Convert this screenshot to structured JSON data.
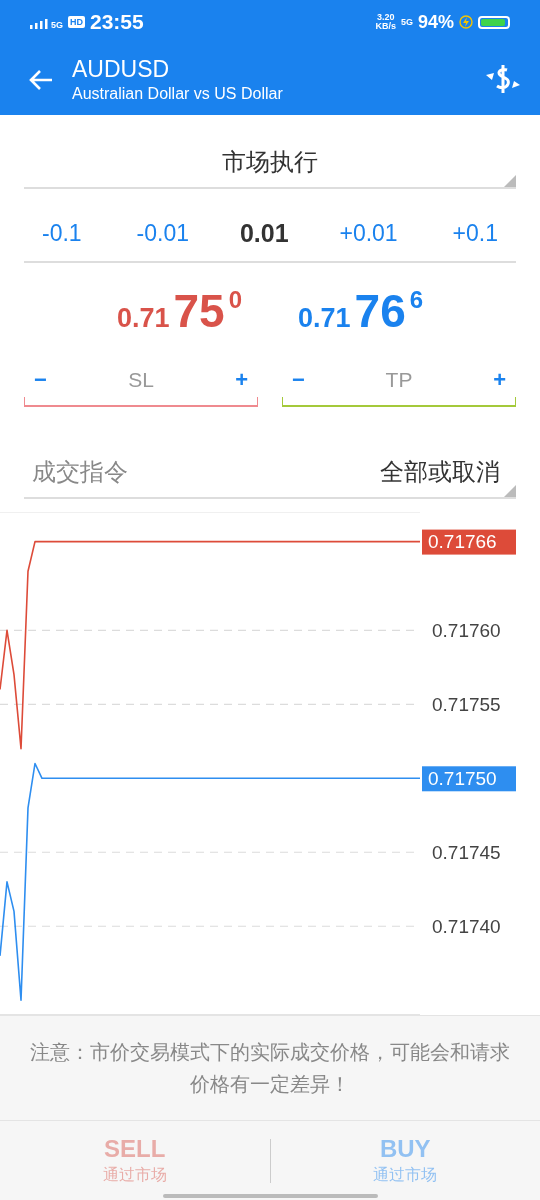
{
  "status_bar": {
    "network_small": "5G",
    "hd": "HD",
    "time": "23:55",
    "speed": "3.20",
    "speed_unit": "KB/s",
    "network": "5G",
    "battery": "94%"
  },
  "header": {
    "title": "AUDUSD",
    "subtitle": "Australian Dollar vs US Dollar"
  },
  "order_type": {
    "value": "市场执行"
  },
  "volume": {
    "decrease": [
      "-0.1",
      "-0.01"
    ],
    "value": "0.01",
    "increase": [
      "+0.01",
      "+0.1"
    ]
  },
  "prices": [
    {
      "kind": "bid",
      "prefix": "0.71",
      "big": "75",
      "sup": "0"
    },
    {
      "kind": "ask",
      "prefix": "0.71",
      "big": "76",
      "sup": "6"
    }
  ],
  "stops": [
    {
      "kind": "sl",
      "minus": "−",
      "placeholder": "SL",
      "plus": "+"
    },
    {
      "kind": "tp",
      "minus": "−",
      "placeholder": "TP",
      "plus": "+"
    }
  ],
  "fill_policy": {
    "label": "成交指令",
    "value": "全部或取消"
  },
  "chart_data": {
    "type": "line",
    "categories": [
      null,
      null,
      null,
      null,
      null,
      null,
      null,
      null,
      null,
      null,
      null,
      null,
      null,
      null,
      null,
      null,
      null,
      null,
      null,
      null,
      null,
      null,
      null,
      null,
      null,
      null,
      null,
      null,
      null,
      null,
      null,
      null,
      null,
      null,
      null,
      null,
      null,
      null,
      null,
      null,
      null,
      null,
      null,
      null,
      null,
      null,
      null,
      null,
      null,
      null,
      null,
      null,
      null,
      null,
      null,
      null,
      null,
      null,
      null,
      null,
      null
    ],
    "grid": true,
    "ylim": [
      0.71734,
      0.71768
    ],
    "yticks": [
      {
        "value": 0.7176,
        "label": "0.71760"
      },
      {
        "value": 0.71755,
        "label": "0.71755"
      },
      {
        "value": 0.71745,
        "label": "0.71745"
      },
      {
        "value": 0.7174,
        "label": "0.71740"
      }
    ],
    "series": [
      {
        "color": "#dd4b39",
        "values": [
          0.71756,
          0.7176,
          0.71757,
          0.71752,
          0.71764,
          0.71766,
          0.71766,
          0.71766,
          0.71766,
          0.71766,
          0.71766,
          0.71766,
          0.71766,
          0.71766,
          0.71766,
          0.71766,
          0.71766,
          0.71766,
          0.71766,
          0.71766,
          0.71766,
          0.71766,
          0.71766,
          0.71766,
          0.71766,
          0.71766,
          0.71766,
          0.71766,
          0.71766,
          0.71766,
          0.71766,
          0.71766,
          0.71766,
          0.71766,
          0.71766,
          0.71766,
          0.71766,
          0.71766,
          0.71766,
          0.71766,
          0.71766,
          0.71766,
          0.71766,
          0.71766,
          0.71766,
          0.71766,
          0.71766,
          0.71766,
          0.71766,
          0.71766,
          0.71766,
          0.71766,
          0.71766,
          0.71766,
          0.71766,
          0.71766,
          0.71766,
          0.71766,
          0.71766,
          0.71766,
          0.71766
        ]
      },
      {
        "color": "#2e8ef0",
        "values": [
          0.71738,
          0.71743,
          0.71741,
          0.71735,
          0.71748,
          0.71751,
          0.7175,
          0.7175,
          0.7175,
          0.7175,
          0.7175,
          0.7175,
          0.7175,
          0.7175,
          0.7175,
          0.7175,
          0.7175,
          0.7175,
          0.7175,
          0.7175,
          0.7175,
          0.7175,
          0.7175,
          0.7175,
          0.7175,
          0.7175,
          0.7175,
          0.7175,
          0.7175,
          0.7175,
          0.7175,
          0.7175,
          0.7175,
          0.7175,
          0.7175,
          0.7175,
          0.7175,
          0.7175,
          0.7175,
          0.7175,
          0.7175,
          0.7175,
          0.7175,
          0.7175,
          0.7175,
          0.7175,
          0.7175,
          0.7175,
          0.7175,
          0.7175,
          0.7175,
          0.7175,
          0.7175,
          0.7175,
          0.7175,
          0.7175,
          0.7175,
          0.7175,
          0.7175,
          0.7175,
          0.7175
        ]
      }
    ],
    "annotations": [
      "0.71766",
      "0.71750"
    ]
  },
  "notice": "注意：市价交易模式下的实际成交价格，可能会和请求价格有一定差异！",
  "actions": [
    {
      "kind": "sell",
      "label": "SELL",
      "sub": "通过市场",
      "disabled": true
    },
    {
      "kind": "buy",
      "label": "BUY",
      "sub": "通过市场",
      "disabled": true
    }
  ]
}
